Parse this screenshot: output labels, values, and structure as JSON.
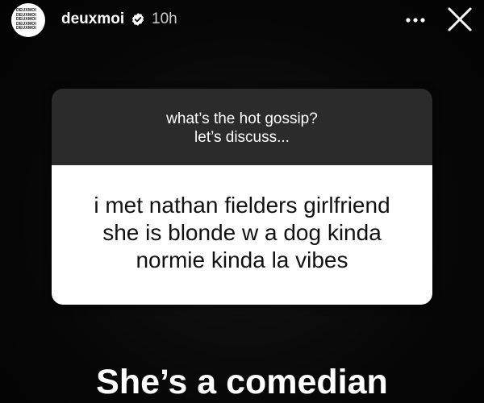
{
  "header": {
    "avatar_logo_lines": [
      "DEUXMOI",
      "DEUXMOI",
      "DEUXMOI",
      "DEUXMOI",
      "DEUXMOI"
    ],
    "username": "deuxmoi",
    "verified_icon": "verified-badge-icon",
    "timestamp": "10h",
    "more_icon": "more-dots-icon",
    "close_icon": "close-icon"
  },
  "question_card": {
    "question_lines": [
      "what’s the hot gossip?",
      "let’s discuss..."
    ],
    "answer_lines": [
      "i met nathan fielders girlfriend",
      "she is blonde w a dog kinda",
      "normie kinda la vibes"
    ]
  },
  "caption": "She’s a comedian",
  "colors": {
    "background": "#050505",
    "question_bg": "#2b2b2b",
    "answer_bg": "#ffffff",
    "text_light": "#ffffff",
    "text_dark": "#111111"
  }
}
